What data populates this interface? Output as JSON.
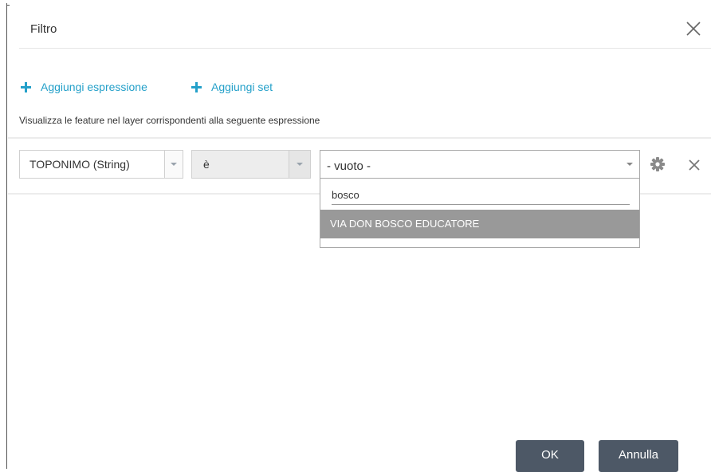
{
  "dialog": {
    "title": "Filtro"
  },
  "actions": {
    "add_expression": "Aggiungi espressione",
    "add_set": "Aggiungi set"
  },
  "description": "Visualizza le feature nel layer corrispondenti alla seguente espressione",
  "expression_row": {
    "field": "TOPONIMO (String)",
    "operator": "è",
    "value_placeholder": "- vuoto -"
  },
  "value_dropdown": {
    "search_value": "bosco",
    "options": [
      "VIA DON BOSCO EDUCATORE"
    ]
  },
  "buttons": {
    "ok": "OK",
    "cancel": "Annulla"
  },
  "colors": {
    "accent": "#24a0c9",
    "button_bg": "#4d5866",
    "highlight": "#999999"
  },
  "icons": [
    "close-icon",
    "plus-icon",
    "chevron-down-icon",
    "gear-icon"
  ]
}
